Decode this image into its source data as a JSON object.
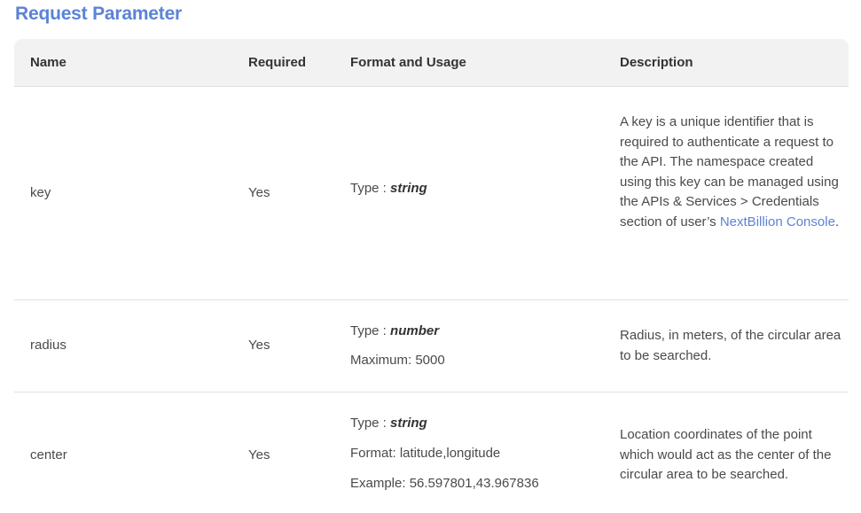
{
  "title": "Request Parameter",
  "columns": {
    "name": "Name",
    "required": "Required",
    "format": "Format and Usage",
    "description": "Description"
  },
  "rows": [
    {
      "name": "key",
      "required": "Yes",
      "type_prefix": "Type : ",
      "type_value": "string",
      "desc_before": "A key is a unique identifier that is required to authenticate a request to the API. The namespace created using this key can be managed using the APIs & Services > Credentials section of user’s ",
      "desc_link": "NextBillion Console",
      "desc_after": "."
    },
    {
      "name": "radius",
      "required": "Yes",
      "type_prefix": "Type : ",
      "type_value": "number",
      "extra1": "Maximum: 5000",
      "desc": "Radius, in meters, of the circular area to be searched."
    },
    {
      "name": "center",
      "required": "Yes",
      "type_prefix": "Type : ",
      "type_value": "string",
      "extra1": "Format: latitude,longitude",
      "extra2": "Example: 56.597801,43.967836",
      "desc": "Location coordinates of the point which would act as the center of the circular area to be searched."
    }
  ]
}
